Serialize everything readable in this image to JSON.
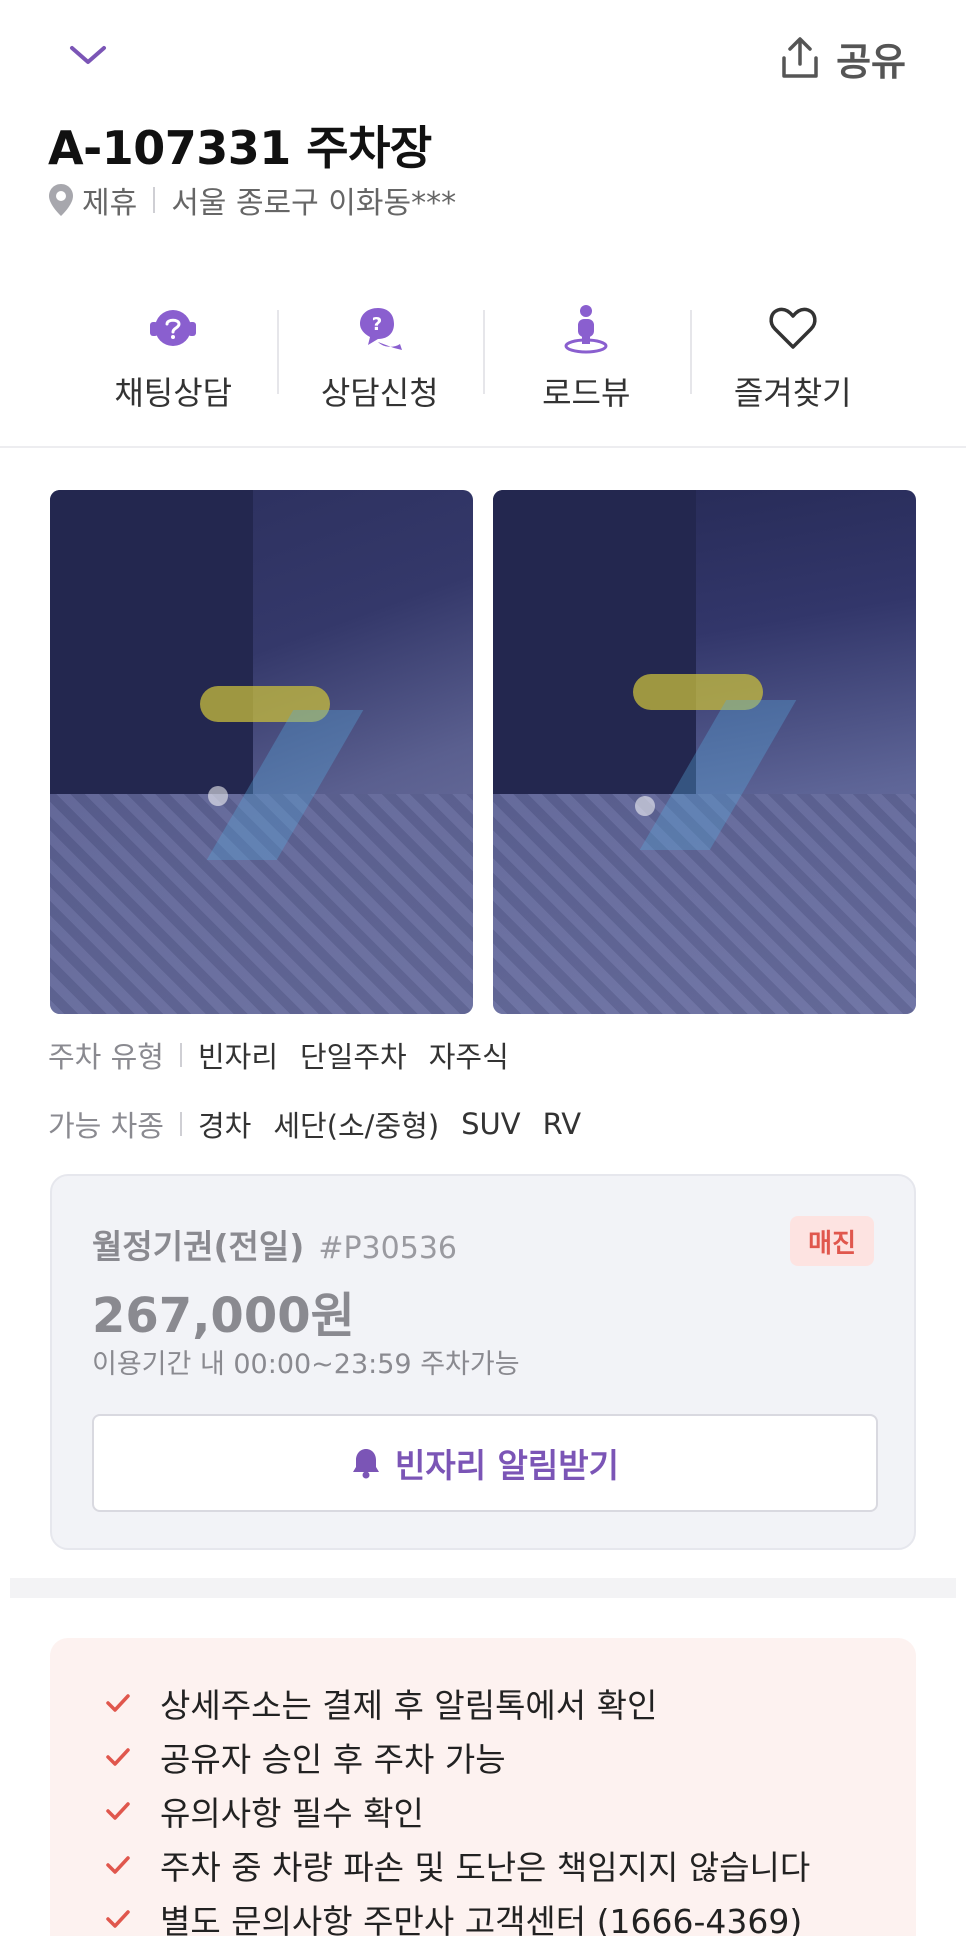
{
  "header": {
    "share_label": "공유",
    "title": "A-107331 주차장",
    "tag": "제휴",
    "address": "서울 종로구 이화동***"
  },
  "actions": [
    {
      "label": "채팅상담",
      "icon": "chat-bot-icon"
    },
    {
      "label": "상담신청",
      "icon": "consult-icon"
    },
    {
      "label": "로드뷰",
      "icon": "roadview-person-icon"
    },
    {
      "label": "즐겨찾기",
      "icon": "heart-icon"
    }
  ],
  "info": {
    "parking_type_label": "주차 유형",
    "parking_types": [
      "빈자리",
      "단일주차",
      "자주식"
    ],
    "car_type_label": "가능 차종",
    "car_types": [
      "경차",
      "세단(소/중형)",
      "SUV",
      "RV"
    ]
  },
  "ticket": {
    "name": "월정기권(전일)",
    "code": "#P30536",
    "badge": "매진",
    "price": "267,000원",
    "period": "이용기간 내 00:00~23:59 주차가능",
    "alert_button": "빈자리 알림받기"
  },
  "notices": [
    "상세주소는 결제 후 알림톡에서 확인",
    "공유자 승인 후 주차 가능",
    "유의사항 필수 확인",
    "주차 중 차량 파손 및 도난은 책임지지 않습니다",
    "별도 문의사항 주만사 고객센터 (1666-4369)"
  ],
  "colors": {
    "accent": "#7b55b6",
    "badge_bg": "#fde3e1",
    "badge_text": "#e0574d",
    "notice_bg": "#fdf2f0",
    "check": "#e0574d"
  }
}
